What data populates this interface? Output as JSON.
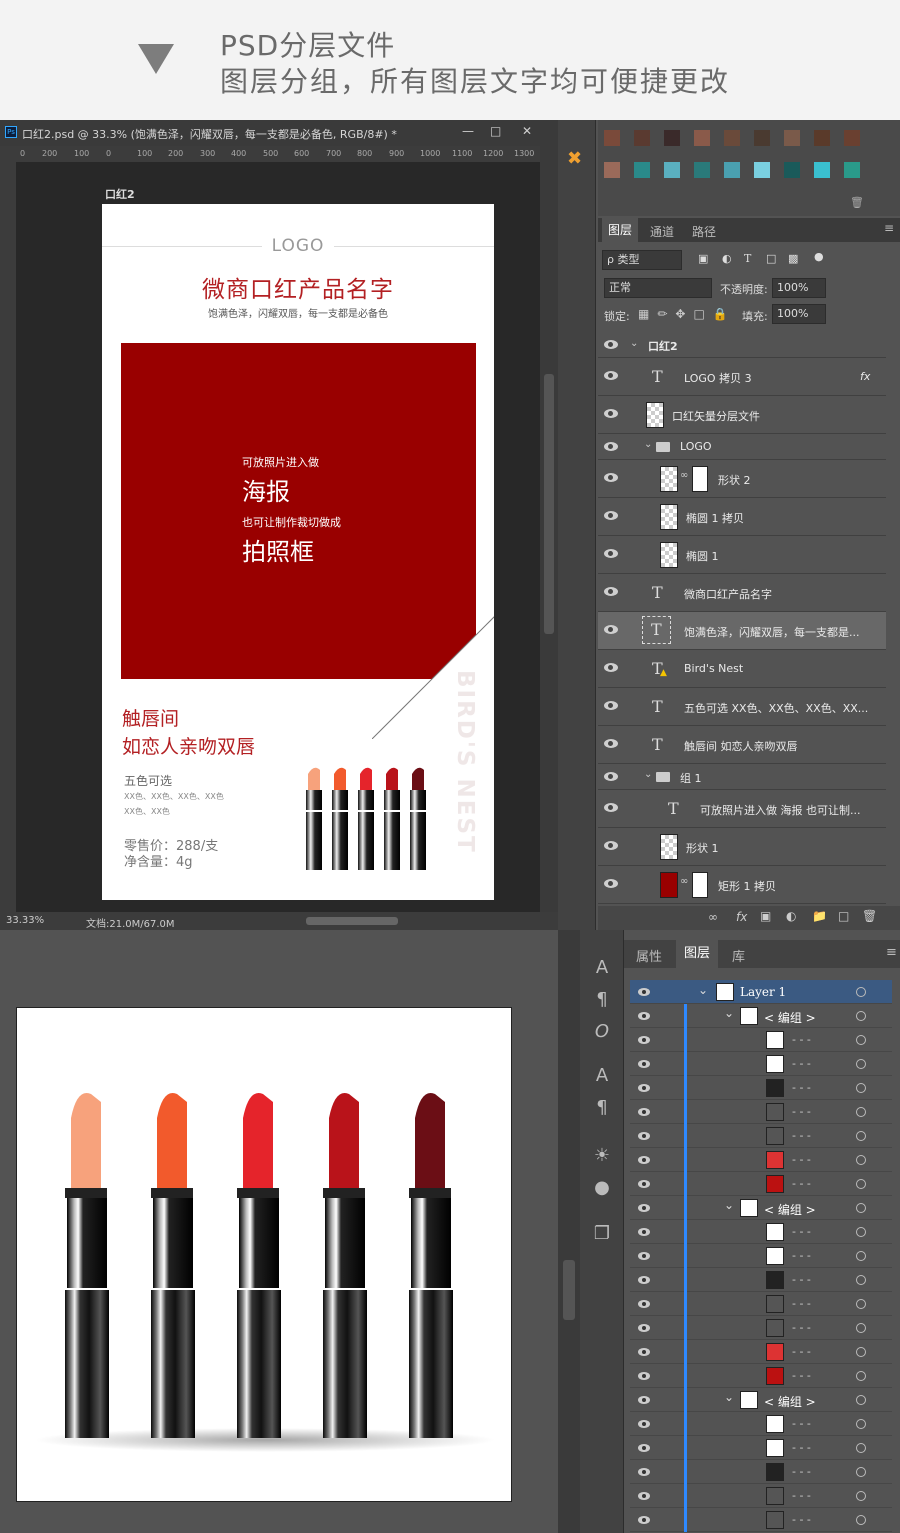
{
  "header": {
    "line1": "PSD分层文件",
    "line2": "图层分组，所有图层文字均可便捷更改"
  },
  "ps": {
    "doc_title": "口红2.psd @ 33.3% (饱满色泽，闪耀双唇，每一支都是必备色, RGB/8#) *",
    "ruler_ticks": [
      "0",
      "200",
      "100",
      "0",
      "100",
      "200",
      "300",
      "400",
      "500",
      "600",
      "700",
      "800",
      "900",
      "1000",
      "1100",
      "1200",
      "1300"
    ],
    "zoom": "33.33%",
    "doc_size": "文档:21.0M/67.0M",
    "artboard_label": "口红2",
    "artboard": {
      "logo": "LOGO",
      "title": "微商口红产品名字",
      "subtitle": "饱满色泽，闪耀双唇，每一支都是必备色",
      "photo_hint1": "可放照片进入做",
      "photo_big1": "海报",
      "photo_hint2": "也可让制作裁切做成",
      "photo_big2": "拍照框",
      "slogan1": "触唇间",
      "slogan2": "如恋人亲吻双唇",
      "colors_title": "五色可选",
      "colors_line1": "XX色、XX色、XX色、XX色",
      "colors_line2": "XX色、XX色",
      "price": "零售价：288/支",
      "net": "净含量：4g",
      "watermark": "BIRD'S NEST"
    },
    "panel_tabs": [
      "图层",
      "通道",
      "路径"
    ],
    "filter_label": "ρ 类型",
    "blend_mode": "正常",
    "opacity_label": "不透明度:",
    "opacity": "100%",
    "lock_label": "锁定:",
    "fill_label": "填充:",
    "fill": "100%",
    "layers": [
      {
        "name": "口红2",
        "kind": "group"
      },
      {
        "name": "LOGO 拷贝 3",
        "kind": "text",
        "fx": "fx"
      },
      {
        "name": "口红矢量分层文件",
        "kind": "smart"
      },
      {
        "name": "LOGO",
        "kind": "group"
      },
      {
        "name": "形状 2",
        "kind": "shape"
      },
      {
        "name": "椭圆 1 拷贝",
        "kind": "smart"
      },
      {
        "name": "椭圆 1",
        "kind": "smart"
      },
      {
        "name": "微商口红产品名字",
        "kind": "text"
      },
      {
        "name": "饱满色泽，闪耀双唇，每一支都是...",
        "kind": "text"
      },
      {
        "name": "Bird's Nest",
        "kind": "text"
      },
      {
        "name": "五色可选 XX色、XX色、XX色、XX...",
        "kind": "text"
      },
      {
        "name": "触唇间 如恋人亲吻双唇",
        "kind": "text"
      },
      {
        "name": "组 1",
        "kind": "group"
      },
      {
        "name": "可放照片进入做 海报 也可让制...",
        "kind": "text"
      },
      {
        "name": "形状 1",
        "kind": "smart"
      },
      {
        "name": "矩形 1 拷贝",
        "kind": "shape"
      }
    ]
  },
  "ai": {
    "tabs": [
      "属性",
      "图层",
      "库"
    ],
    "layer1": "Layer 1",
    "group_label": "< 编组 >",
    "dots": "- - -"
  },
  "colors": {
    "brand_red": "#990000",
    "title_red": "#b32023",
    "lipsticks": [
      "#f7a27c",
      "#f25a2c",
      "#e5242b",
      "#b9131a",
      "#6b0e15"
    ]
  }
}
